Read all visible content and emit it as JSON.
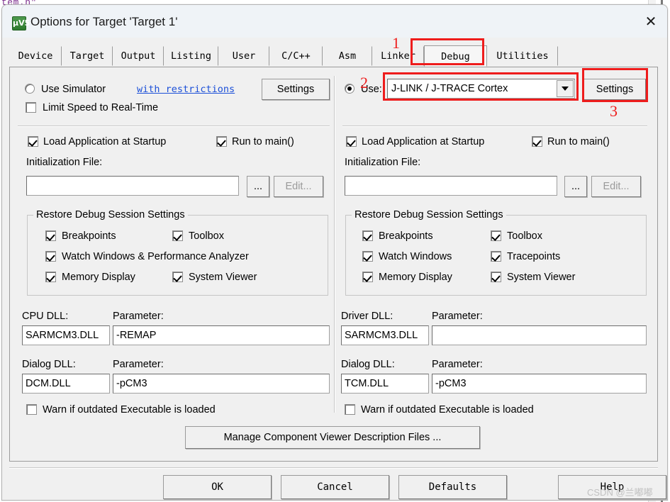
{
  "background": {
    "code_fragment": "tem.h\""
  },
  "window": {
    "title": "Options for Target 'Target 1'",
    "icon": "uvision-logo-icon",
    "icon_text": "µV5",
    "close_label": "✕"
  },
  "tabs": [
    {
      "label": "Device",
      "selected": false
    },
    {
      "label": "Target",
      "selected": false
    },
    {
      "label": "Output",
      "selected": false
    },
    {
      "label": "Listing",
      "selected": false
    },
    {
      "label": "User",
      "selected": false
    },
    {
      "label": "C/C++",
      "selected": false
    },
    {
      "label": "Asm",
      "selected": false
    },
    {
      "label": "Linker",
      "selected": false
    },
    {
      "label": "Debug",
      "selected": true
    },
    {
      "label": "Utilities",
      "selected": false
    }
  ],
  "simulator": {
    "radio_label": "Use Simulator",
    "radio_checked": false,
    "restrictions_link": "with restrictions",
    "settings_button": "Settings",
    "limit_speed_label": "Limit Speed to Real-Time",
    "limit_speed_checked": false,
    "load_app_label": "Load Application at Startup",
    "load_app_checked": true,
    "run_to_main_label": "Run to main()",
    "run_to_main_checked": true,
    "init_file_label": "Initialization File:",
    "init_file_value": "",
    "init_file_placeholder": "",
    "browse_button": "...",
    "edit_button": "Edit...",
    "restore_group_title": "Restore Debug Session Settings",
    "restore_items": [
      {
        "label": "Breakpoints",
        "checked": true
      },
      {
        "label": "Toolbox",
        "checked": true
      },
      {
        "label": "Watch Windows & Performance Analyzer",
        "checked": true
      },
      {
        "label": "Memory Display",
        "checked": true
      },
      {
        "label": "System Viewer",
        "checked": true
      }
    ],
    "cpu_dll_label": "CPU DLL:",
    "cpu_dll_value": "SARMCM3.DLL",
    "cpu_param_label": "Parameter:",
    "cpu_param_value": "-REMAP",
    "dialog_dll_label": "Dialog DLL:",
    "dialog_dll_value": "DCM.DLL",
    "dialog_param_label": "Parameter:",
    "dialog_param_value": "-pCM3",
    "warn_label": "Warn if outdated Executable is loaded",
    "warn_checked": false
  },
  "debugger": {
    "radio_label": "Use:",
    "radio_checked": true,
    "driver_selected": "J-LINK / J-TRACE Cortex",
    "settings_button": "Settings",
    "load_app_label": "Load Application at Startup",
    "load_app_checked": true,
    "run_to_main_label": "Run to main()",
    "run_to_main_checked": true,
    "init_file_label": "Initialization File:",
    "init_file_value": "",
    "browse_button": "...",
    "edit_button": "Edit...",
    "restore_group_title": "Restore Debug Session Settings",
    "restore_items": [
      {
        "label": "Breakpoints",
        "checked": true
      },
      {
        "label": "Toolbox",
        "checked": true
      },
      {
        "label": "Watch Windows",
        "checked": true
      },
      {
        "label": "Tracepoints",
        "checked": true
      },
      {
        "label": "Memory Display",
        "checked": true
      },
      {
        "label": "System Viewer",
        "checked": true
      }
    ],
    "driver_dll_label": "Driver DLL:",
    "driver_dll_value": "SARMCM3.DLL",
    "driver_param_label": "Parameter:",
    "driver_param_value": "",
    "dialog_dll_label": "Dialog DLL:",
    "dialog_dll_value": "TCM.DLL",
    "dialog_param_label": "Parameter:",
    "dialog_param_value": "-pCM3",
    "warn_label": "Warn if outdated Executable is loaded",
    "warn_checked": false
  },
  "manage_button": "Manage Component Viewer Description Files ...",
  "footer": {
    "ok": "OK",
    "cancel": "Cancel",
    "defaults": "Defaults",
    "help": "Help"
  },
  "annotations": [
    {
      "id": "1",
      "target": "debug-tab"
    },
    {
      "id": "2",
      "target": "driver-dropdown"
    },
    {
      "id": "3",
      "target": "debugger-settings-button"
    }
  ],
  "annotation_color": "#ee1c1c",
  "watermark": "CSDN @兰嘟嘟"
}
